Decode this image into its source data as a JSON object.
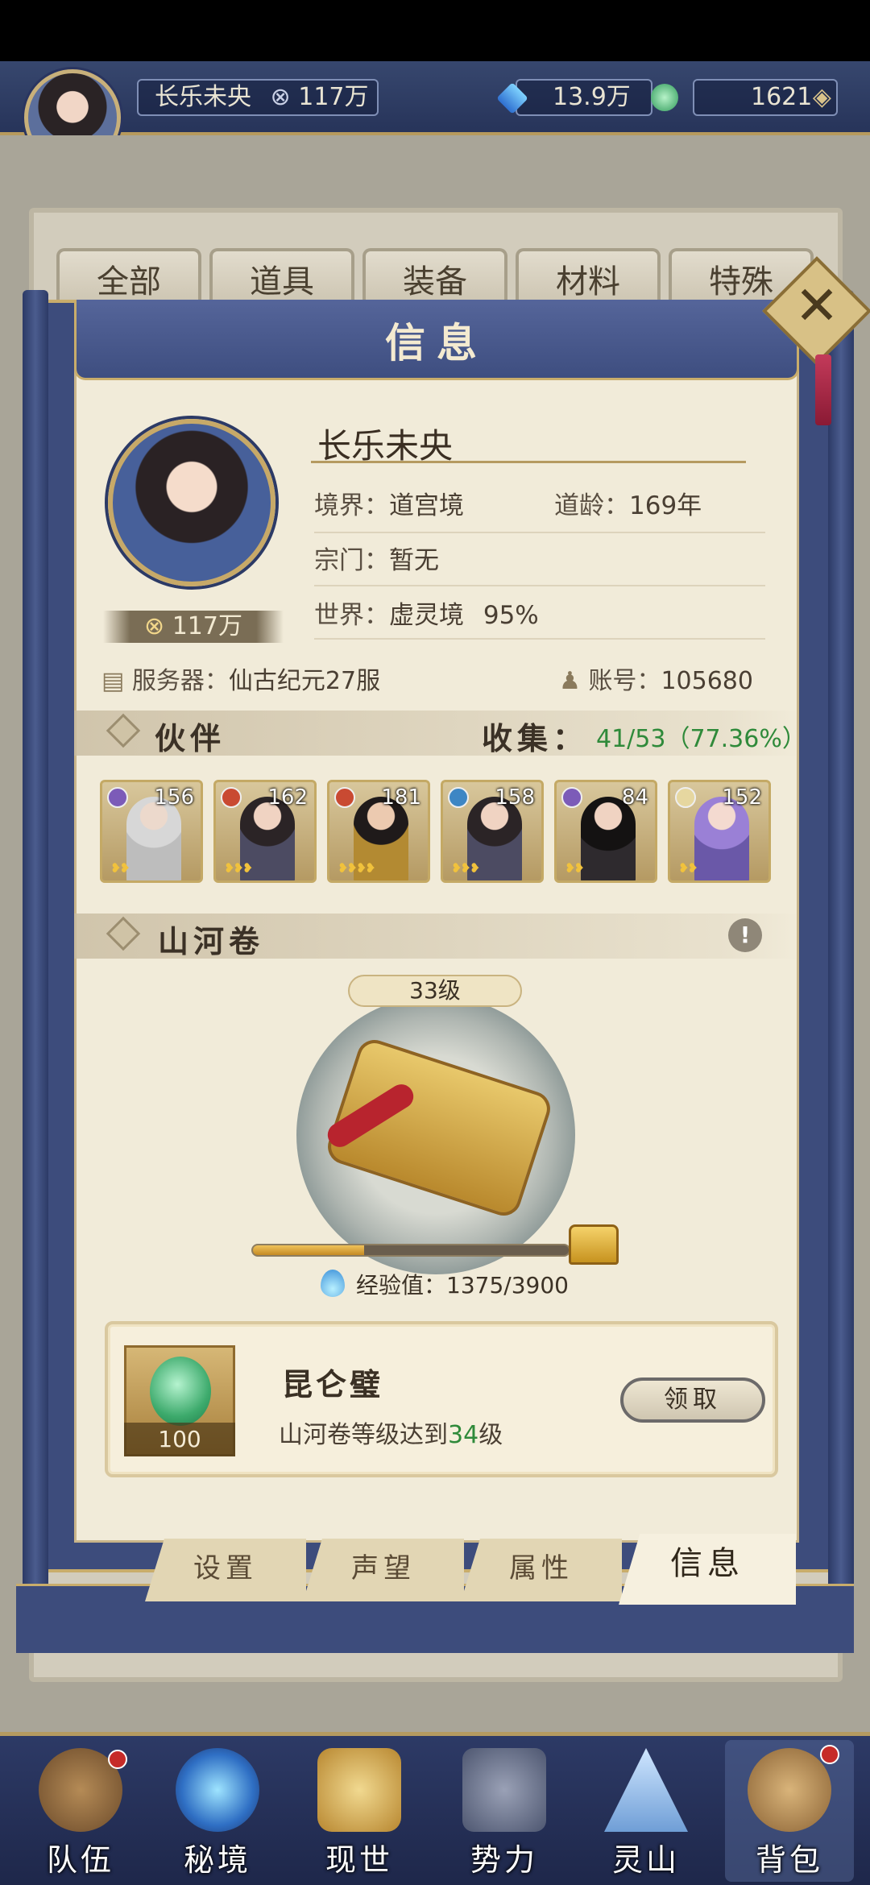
{
  "top_bar": {
    "player_name": "长乐未央",
    "power": "117万",
    "crystal": "13.9万",
    "jade": "1621"
  },
  "bg_tabs": [
    "全部",
    "道具",
    "装备",
    "材料",
    "特殊"
  ],
  "dialog": {
    "title": "信息",
    "close_icon": "close-icon"
  },
  "profile": {
    "name": "长乐未央",
    "power_badge": "117万",
    "realm_label": "境界：",
    "realm_value": "道宫境",
    "age_label": "道龄：",
    "age_value": "169年",
    "sect_label": "宗门：",
    "sect_value": "暂无",
    "world_label": "世界：",
    "world_value": "虚灵境",
    "world_percent": "95%",
    "server_label": "服务器：",
    "server_value": "仙古纪元27服",
    "account_label": "账号：",
    "account_value": "105680"
  },
  "partners": {
    "title": "伙伴",
    "collect_label": "收集：",
    "collect_value": "41/53（77.36%）",
    "items": [
      {
        "level": "156",
        "element_color": "#7c5bb8"
      },
      {
        "level": "162",
        "element_color": "#c94a32"
      },
      {
        "level": "181",
        "element_color": "#c94a32"
      },
      {
        "level": "158",
        "element_color": "#3d86c4"
      },
      {
        "level": "84",
        "element_color": "#7c5bb8"
      },
      {
        "level": "152",
        "element_color": "#e6d7a0"
      }
    ]
  },
  "mountain_scroll": {
    "title": "山河卷",
    "level": "33级",
    "xp_label": "经验值：",
    "xp_value": "1375/3900",
    "xp_fraction": 0.3526
  },
  "reward": {
    "name": "昆仑璧",
    "qty": "100",
    "desc_prefix": "山河卷等级达到",
    "desc_level": "34",
    "desc_suffix": "级",
    "claim_label": "领取"
  },
  "bottom_tabs": [
    "设置",
    "声望",
    "属性",
    "信息"
  ],
  "dock": [
    "队伍",
    "秘境",
    "现世",
    "势力",
    "灵山",
    "背包"
  ],
  "colors": {
    "accent_green": "#2f8a3a",
    "panel_blue": "#3d4c7c",
    "gold": "#c9ad6b"
  }
}
